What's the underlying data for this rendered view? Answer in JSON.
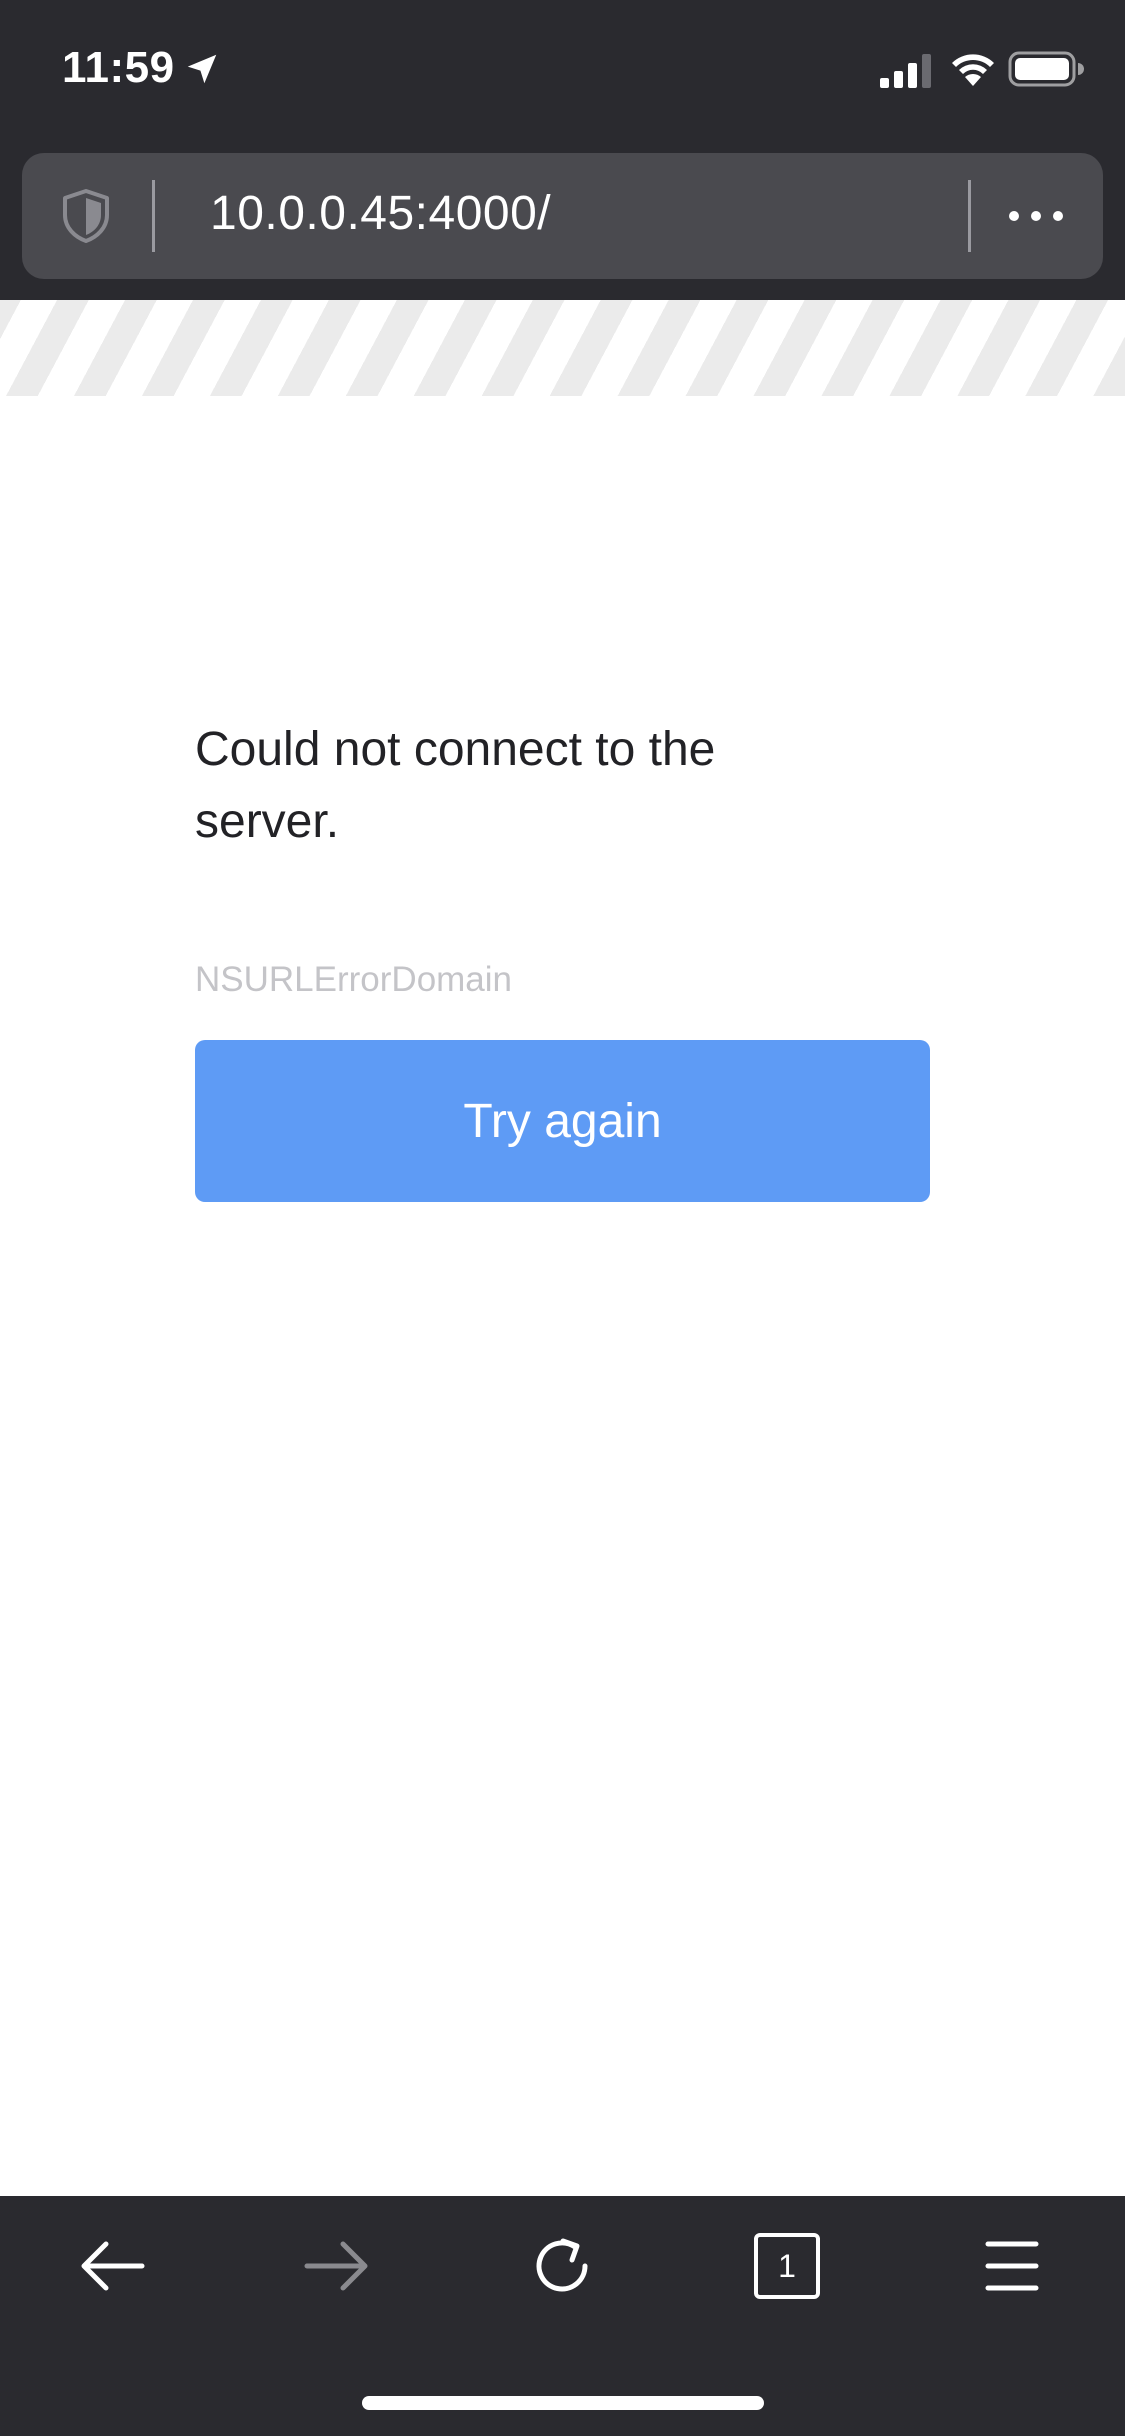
{
  "status_bar": {
    "time": "11:59",
    "location_icon": "location-arrow-icon",
    "signal_icon": "cellular-signal-icon",
    "wifi_icon": "wifi-icon",
    "battery_icon": "battery-icon"
  },
  "address_bar": {
    "url": "10.0.0.45:4000/",
    "tracking_icon": "shield-icon",
    "menu_icon": "more-icon"
  },
  "error_page": {
    "message": "Could not connect to the server.",
    "domain": "NSURLErrorDomain",
    "retry_label": "Try again"
  },
  "bottom_toolbar": {
    "back_icon": "back-arrow-icon",
    "forward_icon": "forward-arrow-icon",
    "reload_icon": "reload-icon",
    "tab_count": "1",
    "menu_icon": "hamburger-menu-icon"
  },
  "colors": {
    "chrome_background": "#2a2a2f",
    "url_field_background": "#4a4a4f",
    "accent_button": "#5e9bf5",
    "error_text": "#222226",
    "muted_text": "#c4c4c8",
    "disabled_icon": "#8a8a8f"
  }
}
